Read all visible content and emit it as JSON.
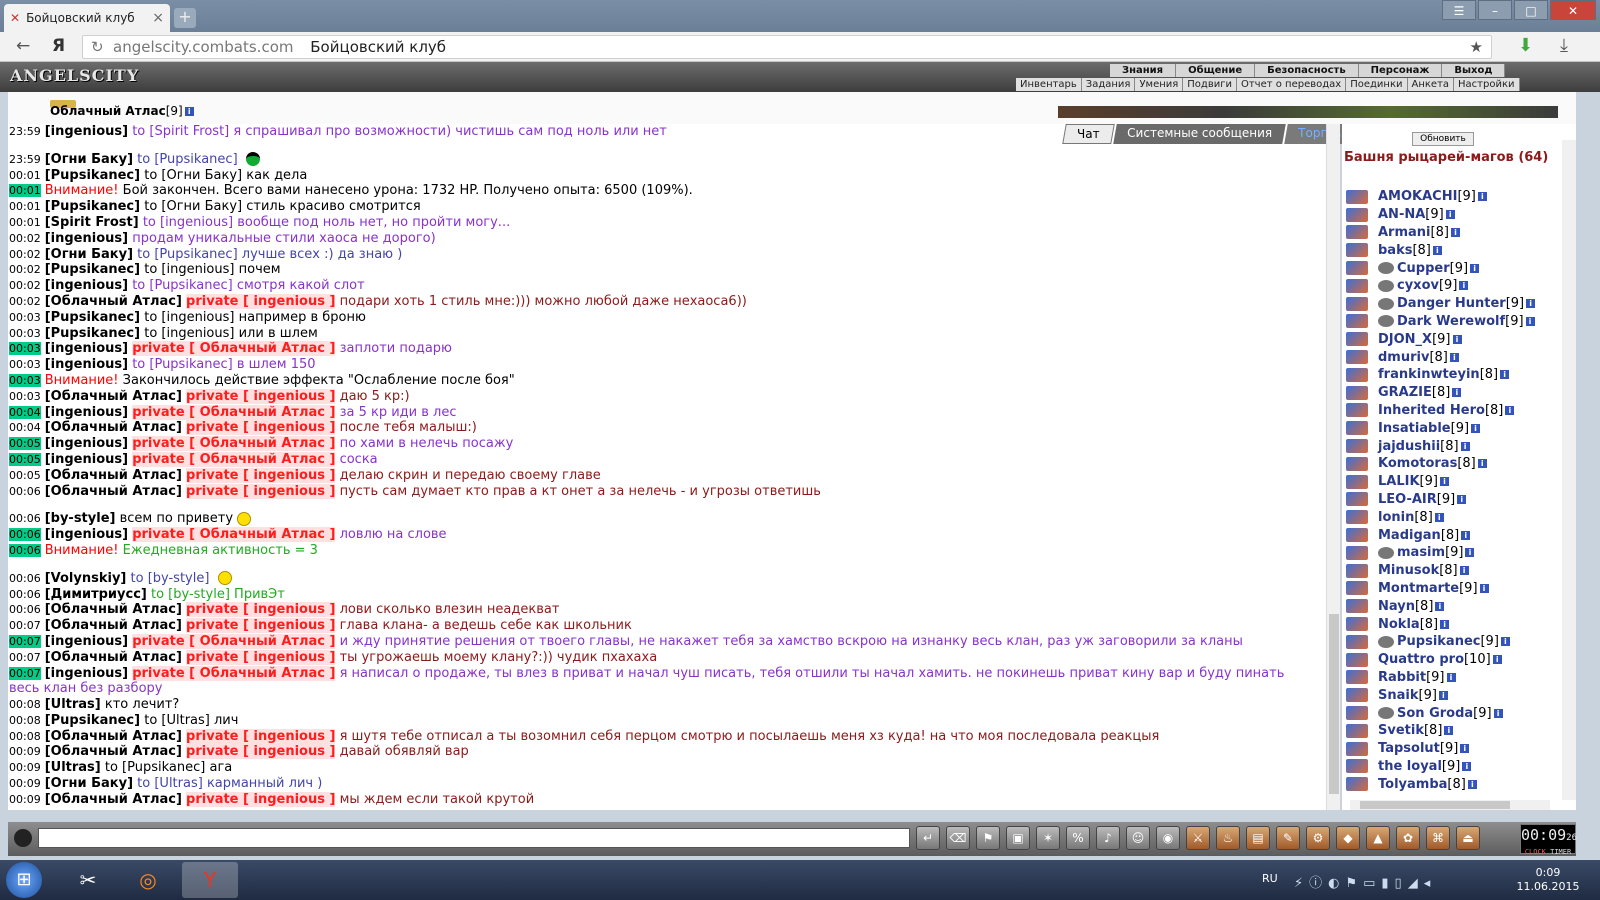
{
  "browser": {
    "tab_title": "Бойцовский клуб",
    "domain": "angelscity.combats.com",
    "page_title": "Бойцовский клуб"
  },
  "game": {
    "logo": "ANGELSCITY",
    "menu": [
      "Знания",
      "Общение",
      "Безопасность",
      "Персонаж",
      "Выход"
    ],
    "submenu": [
      "Инвентарь",
      "Задания",
      "Умения",
      "Подвиги",
      "Отчет о переводах",
      "Поединки",
      "Анкета",
      "Настройки"
    ],
    "character": "Облачный Атлас",
    "character_level": "[9]",
    "tabs": {
      "chat": "Чат",
      "system": "Системные сообщения",
      "trade": "Торговля"
    }
  },
  "chat": [
    {
      "t": "23:59",
      "hl": false,
      "nick": "[ingenious]",
      "kind": "to",
      "to": "to [Spirit Frost]",
      "msg": "я спрашивал про возможности) чистишь сам под ноль или нет",
      "style": "pu"
    },
    {
      "gap": true
    },
    {
      "t": "23:59",
      "hl": false,
      "nick": "[Огни Баку]",
      "kind": "to",
      "to": "to [Pupsikanec]",
      "msg": "",
      "style": "to",
      "hat": true
    },
    {
      "t": "00:01",
      "hl": false,
      "nick": "[Pupsikanec]",
      "kind": "to",
      "to": "to [Огни Баку]",
      "msg": "как дела",
      "style": ""
    },
    {
      "t": "00:01",
      "hl": true,
      "sys": "Внимание!",
      "msg": "Бой закончен. Всего вами нанесено урона: 1732 HP. Получено опыта: 6500 (109%).",
      "style": ""
    },
    {
      "t": "00:01",
      "hl": false,
      "nick": "[Pupsikanec]",
      "kind": "to",
      "to": "to [Огни Баку]",
      "msg": "стиль красиво смотрится",
      "style": ""
    },
    {
      "t": "00:01",
      "hl": false,
      "nick": "[Spirit Frost]",
      "kind": "to",
      "to": "to [ingenious]",
      "msg": "вообще под ноль нет, но пройти могу...",
      "style": "pu"
    },
    {
      "t": "00:02",
      "hl": false,
      "nick": "[ingenious]",
      "kind": "say",
      "msg": "продам уникальные стили хаоса не дорого)",
      "style": "pu"
    },
    {
      "t": "00:02",
      "hl": false,
      "nick": "[Огни Баку]",
      "kind": "to",
      "to": "to [Pupsikanec]",
      "msg": "лучше всех :) да знаю )",
      "style": "to"
    },
    {
      "t": "00:02",
      "hl": false,
      "nick": "[Pupsikanec]",
      "kind": "to",
      "to": "to [ingenious]",
      "msg": "почем",
      "style": ""
    },
    {
      "t": "00:02",
      "hl": false,
      "nick": "[ingenious]",
      "kind": "to",
      "to": "to [Pupsikanec]",
      "msg": "смотря какой слот",
      "style": "pu"
    },
    {
      "t": "00:02",
      "hl": false,
      "nick": "[Облачный Атлас]",
      "kind": "private",
      "priv": "private [ ingenious ]",
      "msg": "подари хоть 1 стиль мне:))) можно любой даже нехаоса6))",
      "style": "dr"
    },
    {
      "t": "00:03",
      "hl": false,
      "nick": "[Pupsikanec]",
      "kind": "to",
      "to": "to [ingenious]",
      "msg": "например в броню",
      "style": ""
    },
    {
      "t": "00:03",
      "hl": false,
      "nick": "[Pupsikanec]",
      "kind": "to",
      "to": "to [ingenious]",
      "msg": "или в шлем",
      "style": ""
    },
    {
      "t": "00:03",
      "hl": true,
      "nick": "[ingenious]",
      "kind": "private",
      "priv": "private [ Облачный Атлас ]",
      "msg": "заплоти подарю",
      "style": "pu"
    },
    {
      "t": "00:03",
      "hl": false,
      "nick": "[ingenious]",
      "kind": "to",
      "to": "to [Pupsikanec]",
      "msg": "в шлем 150",
      "style": "pu"
    },
    {
      "t": "00:03",
      "hl": true,
      "sys": "Внимание!",
      "msg": "Закончилось действие эффекта \"Ослабление после боя\"",
      "style": ""
    },
    {
      "t": "00:03",
      "hl": false,
      "nick": "[Облачный Атлас]",
      "kind": "private",
      "priv": "private [ ingenious ]",
      "msg": "даю 5 кр:)",
      "style": "dr"
    },
    {
      "t": "00:04",
      "hl": true,
      "nick": "[ingenious]",
      "kind": "private",
      "priv": "private [ Облачный Атлас ]",
      "msg": "за 5 кр иди в лес",
      "style": "pu"
    },
    {
      "t": "00:04",
      "hl": false,
      "nick": "[Облачный Атлас]",
      "kind": "private",
      "priv": "private [ ingenious ]",
      "msg": "после тебя малыш:)",
      "style": "dr"
    },
    {
      "t": "00:05",
      "hl": true,
      "nick": "[ingenious]",
      "kind": "private",
      "priv": "private [ Облачный Атлас ]",
      "msg": "по хами в нелечь посажу",
      "style": "pu"
    },
    {
      "t": "00:05",
      "hl": true,
      "nick": "[ingenious]",
      "kind": "private",
      "priv": "private [ Облачный Атлас ]",
      "msg": "соска",
      "style": "pu"
    },
    {
      "t": "00:05",
      "hl": false,
      "nick": "[Облачный Атлас]",
      "kind": "private",
      "priv": "private [ ingenious ]",
      "msg": "делаю скрин и передаю своему главе",
      "style": "dr"
    },
    {
      "t": "00:06",
      "hl": false,
      "nick": "[Облачный Атлас]",
      "kind": "private",
      "priv": "private [ ingenious ]",
      "msg": "пусть сам думает кто прав а кт онет а за нелечь - и угрозы ответишь",
      "style": "dr"
    },
    {
      "gap": true
    },
    {
      "t": "00:06",
      "hl": false,
      "nick": "[by-style]",
      "kind": "say",
      "msg": "всем по привету",
      "style": "",
      "smile": true
    },
    {
      "t": "00:06",
      "hl": true,
      "nick": "[ingenious]",
      "kind": "private",
      "priv": "private [ Облачный Атлас ]",
      "msg": "ловлю на слове",
      "style": "pu"
    },
    {
      "t": "00:06",
      "hl": true,
      "sys": "Внимание!",
      "msg": "Ежедневная активность = 3",
      "style": "grn"
    },
    {
      "gap": true
    },
    {
      "t": "00:06",
      "hl": false,
      "nick": "[Volynskiy]",
      "kind": "to",
      "to": "to [by-style]",
      "msg": "",
      "style": "to",
      "smile": true
    },
    {
      "t": "00:06",
      "hl": false,
      "nick": "[Димитриусс]",
      "kind": "to",
      "to": "to [by-style]",
      "msg": "ПривЭт",
      "style": "grn"
    },
    {
      "t": "00:06",
      "hl": false,
      "nick": "[Облачный Атлас]",
      "kind": "private",
      "priv": "private [ ingenious ]",
      "msg": "лови сколько влезин неадекват",
      "style": "dr"
    },
    {
      "t": "00:07",
      "hl": false,
      "nick": "[Облачный Атлас]",
      "kind": "private",
      "priv": "private [ ingenious ]",
      "msg": "глава клана- а ведешь себе как школьник",
      "style": "dr"
    },
    {
      "t": "00:07",
      "hl": true,
      "nick": "[ingenious]",
      "kind": "private",
      "priv": "private [ Облачный Атлас ]",
      "msg": "и жду принятие решения от твоего главы, не накажет тебя за хамство вскрою на изнанку весь клан, раз уж заговорили за кланы",
      "style": "pu"
    },
    {
      "t": "00:07",
      "hl": false,
      "nick": "[Облачный Атлас]",
      "kind": "private",
      "priv": "private [ ingenious ]",
      "msg": "ты угрожаешь моему клану?:)) чудик пхахаха",
      "style": "dr"
    },
    {
      "t": "00:07",
      "hl": true,
      "nick": "[ingenious]",
      "kind": "private",
      "priv": "private [ Облачный Атлас ]",
      "msg": "я написал о продаже, ты влез в приват и начал чуш писать, тебя отшили ты начал хамить. не покинешь приват кину вар и буду пинать",
      "style": "pu"
    },
    {
      "cont": true,
      "msg": "весь клан без разбору",
      "style": "pu"
    },
    {
      "t": "00:08",
      "hl": false,
      "nick": "[Ultras]",
      "kind": "say",
      "msg": "кто лечит?",
      "style": ""
    },
    {
      "t": "00:08",
      "hl": false,
      "nick": "[Pupsikanec]",
      "kind": "to",
      "to": "to [Ultras]",
      "msg": "лич",
      "style": ""
    },
    {
      "t": "00:08",
      "hl": false,
      "nick": "[Облачный Атлас]",
      "kind": "private",
      "priv": "private [ ingenious ]",
      "msg": "я шутя тебе отписал а ты возомнил себя перцом смотрю и посылаешь меня хз куда! на что моя последовала реакцыя",
      "style": "dr"
    },
    {
      "t": "00:09",
      "hl": false,
      "nick": "[Облачный Атлас]",
      "kind": "private",
      "priv": "private [ ingenious ]",
      "msg": "давай обявляй вар",
      "style": "dr"
    },
    {
      "t": "00:09",
      "hl": false,
      "nick": "[Ultras]",
      "kind": "to",
      "to": "to [Pupsikanec]",
      "msg": "ага",
      "style": ""
    },
    {
      "t": "00:09",
      "hl": false,
      "nick": "[Огни Баку]",
      "kind": "to",
      "to": "to [Ultras]",
      "msg": "карманный лич )",
      "style": "to"
    },
    {
      "t": "00:09",
      "hl": false,
      "nick": "[Облачный Атлас]",
      "kind": "private",
      "priv": "private [ ingenious ]",
      "msg": "мы ждем если такой крутой",
      "style": "dr"
    }
  ],
  "userlist": {
    "refresh": "Обновить",
    "room": "Башня рыцарей-магов (64)",
    "users": [
      {
        "n": "AMOKACHI",
        "l": "[9]"
      },
      {
        "n": "AN-NA",
        "l": "[9]"
      },
      {
        "n": "Armani",
        "l": "[8]"
      },
      {
        "n": "baks",
        "l": "[8]"
      },
      {
        "n": "Cupper",
        "l": "[9]",
        "b": true
      },
      {
        "n": "cyxov",
        "l": "[9]",
        "b": true
      },
      {
        "n": "Danger Hunter",
        "l": "[9]",
        "b": true
      },
      {
        "n": "Dark Werewolf",
        "l": "[9]",
        "b": true
      },
      {
        "n": "DJON_X",
        "l": "[9]"
      },
      {
        "n": "dmuriv",
        "l": "[8]"
      },
      {
        "n": "frankinwteyin",
        "l": "[8]"
      },
      {
        "n": "GRAZIE",
        "l": "[8]"
      },
      {
        "n": "Inherited Hero",
        "l": "[8]"
      },
      {
        "n": "Insatiable",
        "l": "[9]"
      },
      {
        "n": "jajdushii",
        "l": "[8]"
      },
      {
        "n": "Komotoras",
        "l": "[8]"
      },
      {
        "n": "LALIK",
        "l": "[9]"
      },
      {
        "n": "LEO-AIR",
        "l": "[9]"
      },
      {
        "n": "lonin",
        "l": "[8]"
      },
      {
        "n": "Madigan",
        "l": "[8]"
      },
      {
        "n": "masim",
        "l": "[9]",
        "b": true
      },
      {
        "n": "Minusok",
        "l": "[8]"
      },
      {
        "n": "Montmarte",
        "l": "[9]"
      },
      {
        "n": "Nayn",
        "l": "[8]"
      },
      {
        "n": "Nokla",
        "l": "[8]"
      },
      {
        "n": "Pupsikanec",
        "l": "[9]",
        "b": true
      },
      {
        "n": "Quattro pro",
        "l": "[10]"
      },
      {
        "n": "Rabbit",
        "l": "[9]"
      },
      {
        "n": "Snaik",
        "l": "[9]"
      },
      {
        "n": "Son Groda",
        "l": "[9]",
        "b": true
      },
      {
        "n": "Svetik",
        "l": "[8]"
      },
      {
        "n": "Tapsolut",
        "l": "[9]"
      },
      {
        "n": "the loyal",
        "l": "[9]"
      },
      {
        "n": "Tolyamba",
        "l": "[8]"
      }
    ]
  },
  "toolbar": {
    "clock": "00:09",
    "clock_sec": "26",
    "clock_label": "CLOCK",
    "timer_label": "TIMER"
  },
  "taskbar": {
    "lang": "RU",
    "time": "0:09",
    "date": "11.06.2015"
  }
}
